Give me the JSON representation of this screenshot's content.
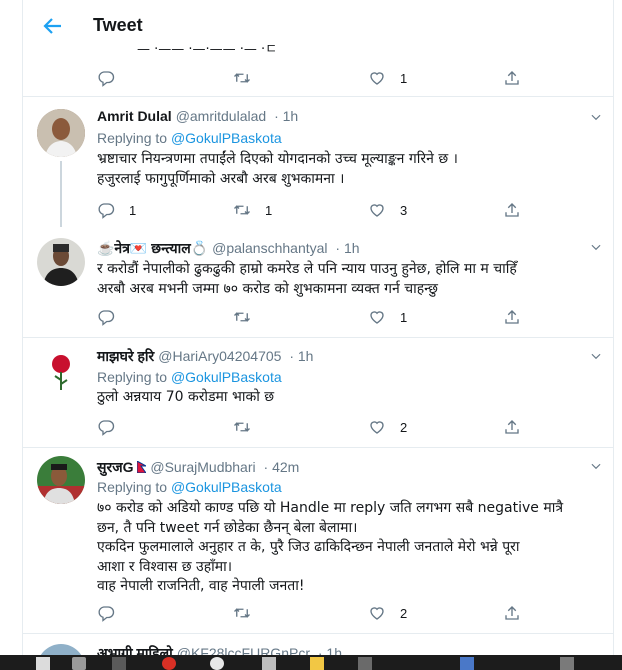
{
  "header": {
    "title": "Tweet"
  },
  "top_actions": {
    "like_count": "1"
  },
  "tweets": [
    {
      "name": "Amrit Dulal",
      "handle": "@amritdulalad",
      "time": "· 1h",
      "replying_label": "Replying to",
      "replying_to": "@GokulPBaskota",
      "lines": [
        "भ्रष्टाचार नियन्त्रणमा तपाईंले दिएको योगदानको  उच्च मूल्याङ्कन गरिने छ ।",
        "हजुरलाई फागुपूर्णिमाको अरबौ अरब शुभकामना  ।"
      ],
      "reply_count": "1",
      "retweet_count": "1",
      "like_count": "3"
    },
    {
      "name": "☕नेत्र💌 छन्त्याल💍",
      "handle": "@palanschhantyal",
      "time": "· 1h",
      "lines": [
        "र करोडौं नेपालीको ढुकढुकी हाम्रो कमरेड ले पनि न्याय पाउनु हुनेछ, होलि मा म चाहिँ",
        "अरबौ अरब मभनी जम्मा ७० करोड को शुभकामना व्यक्त गर्न चाहन्छु"
      ],
      "like_count": "1"
    },
    {
      "name": "माझघरे हरि",
      "handle": "@HariAry04204705",
      "time": "· 1h",
      "replying_label": "Replying to",
      "replying_to": "@GokulPBaskota",
      "lines": [
        "ठुलो अन्नयाय 70 करोडमा भाको छ"
      ],
      "like_count": "2"
    },
    {
      "name": "सुरजG",
      "handle": "@SurajMudbhari",
      "time": "· 42m",
      "replying_label": "Replying to",
      "replying_to": "@GokulPBaskota",
      "lines": [
        "७० करोड को अडियो काण्ड पछि यो Handle मा reply जति लगभग सबै negative मात्रै",
        "छन, तै पनि tweet गर्न छोडेका छैनन् बेला बेलामा।",
        "एकदिन फुलमालाले अनुहार त के, पुरै जिउ ढाकिदिन्छन नेपाली जनताले मेरो भन्ने पूरा",
        "आशा र विश्वास छ उहाँमा।",
        "वाह नेपाली राजनिती, वाह नेपाली जनता!"
      ],
      "like_count": "2"
    },
    {
      "name": "अभागी माहिलो",
      "handle": "@KF28lccFURGnPcr",
      "time": "· 1h"
    }
  ],
  "colors": {
    "accent": "#1da1f2",
    "link": "#1b95e0",
    "muted": "#657786",
    "text": "#14171a",
    "border": "#e6ecf0"
  }
}
